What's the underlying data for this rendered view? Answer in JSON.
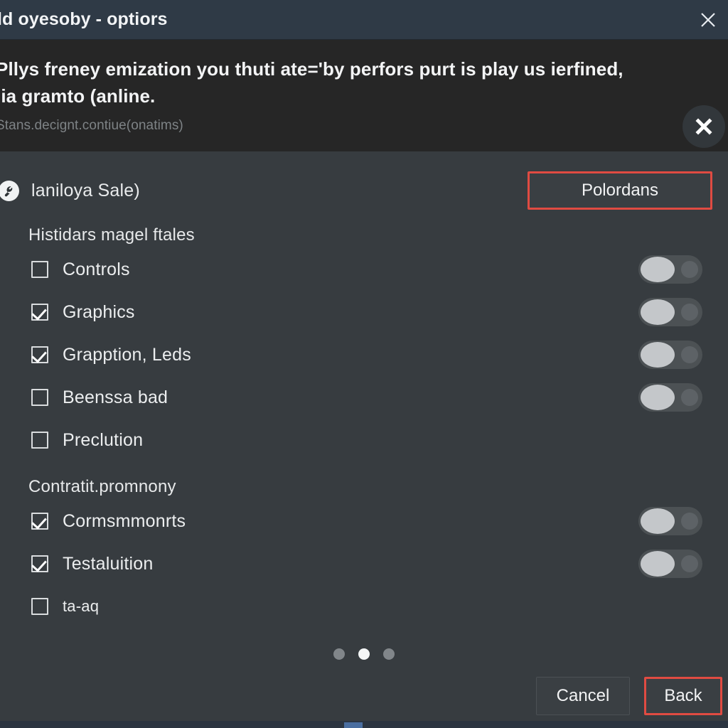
{
  "titlebar": {
    "title": "ld oyesoby - optiors",
    "close_icon": "close-icon"
  },
  "banner": {
    "message": "Pllys freney emization you thuti ate='by perfors purt is play us ierfined,\nlia gramto (anline.",
    "subtext": "Stans.decignt.contiue(onatims)",
    "close_icon": "close-circle-icon"
  },
  "section": {
    "icon": "tool-circle-icon",
    "title": "laniloya Sale)",
    "primary_button": "Polordans",
    "primary_button_accent": "#e04b42"
  },
  "groups": [
    {
      "title": "Histidars magel ftales",
      "rows": [
        {
          "label": "Controls",
          "checked": false,
          "toggle": true
        },
        {
          "label": "Graphics",
          "checked": true,
          "toggle": true
        },
        {
          "label": "Grapption, Leds",
          "checked": true,
          "toggle": true
        },
        {
          "label": "Beenssa bad",
          "checked": false,
          "toggle": true
        },
        {
          "label": "Preclution",
          "checked": false,
          "toggle": false
        }
      ]
    },
    {
      "title": "Contratit.promnony",
      "rows": [
        {
          "label": "Cormsmmonrts",
          "checked": true,
          "toggle": true
        },
        {
          "label": "Testaluition",
          "checked": true,
          "toggle": true
        },
        {
          "label": "ta-aq",
          "checked": false,
          "toggle": false
        }
      ]
    }
  ],
  "pagination": {
    "count": 3,
    "active_index": 1
  },
  "footer": {
    "cancel_label": "Cancel",
    "back_label": "Back",
    "back_accent": "#e04b42"
  }
}
